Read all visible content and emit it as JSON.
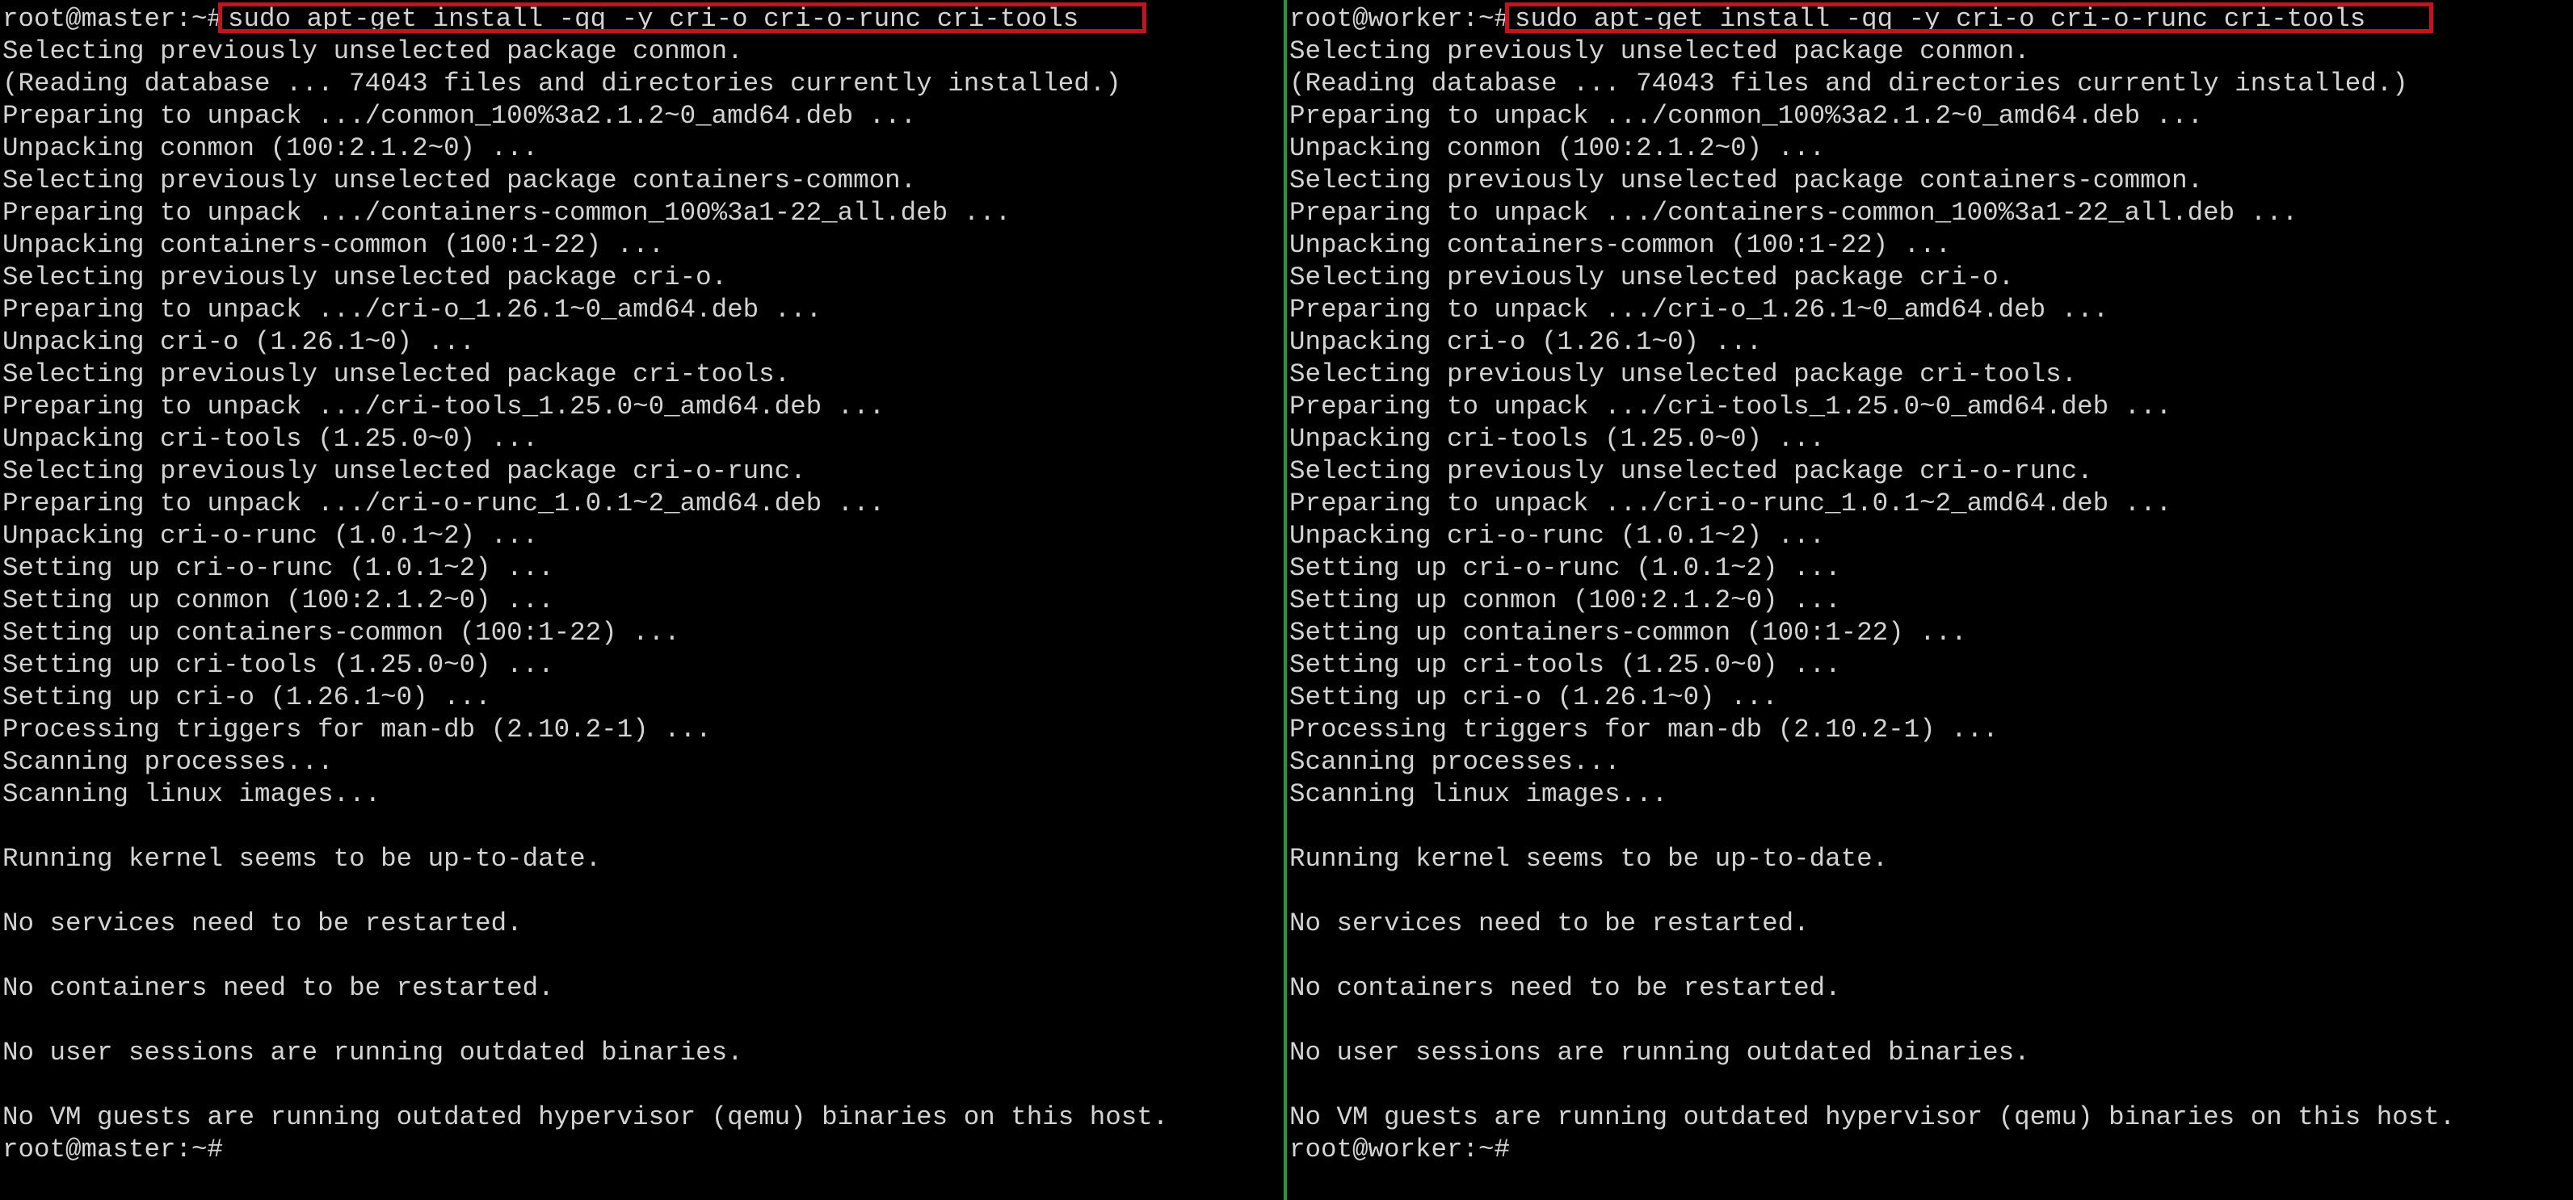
{
  "colors": {
    "background": "#000000",
    "text": "#d3d3d3",
    "divider": "#1d9b3c",
    "highlight": "#c0141f"
  },
  "panes": [
    {
      "prompt": "root@master:~#",
      "command": "sudo apt-get install -qq -y cri-o cri-o-runc cri-tools",
      "output": [
        "Selecting previously unselected package conmon.",
        "(Reading database ... 74043 files and directories currently installed.)",
        "Preparing to unpack .../conmon_100%3a2.1.2~0_amd64.deb ...",
        "Unpacking conmon (100:2.1.2~0) ...",
        "Selecting previously unselected package containers-common.",
        "Preparing to unpack .../containers-common_100%3a1-22_all.deb ...",
        "Unpacking containers-common (100:1-22) ...",
        "Selecting previously unselected package cri-o.",
        "Preparing to unpack .../cri-o_1.26.1~0_amd64.deb ...",
        "Unpacking cri-o (1.26.1~0) ...",
        "Selecting previously unselected package cri-tools.",
        "Preparing to unpack .../cri-tools_1.25.0~0_amd64.deb ...",
        "Unpacking cri-tools (1.25.0~0) ...",
        "Selecting previously unselected package cri-o-runc.",
        "Preparing to unpack .../cri-o-runc_1.0.1~2_amd64.deb ...",
        "Unpacking cri-o-runc (1.0.1~2) ...",
        "Setting up cri-o-runc (1.0.1~2) ...",
        "Setting up conmon (100:2.1.2~0) ...",
        "Setting up containers-common (100:1-22) ...",
        "Setting up cri-tools (1.25.0~0) ...",
        "Setting up cri-o (1.26.1~0) ...",
        "Processing triggers for man-db (2.10.2-1) ...",
        "Scanning processes...",
        "Scanning linux images...",
        "",
        "Running kernel seems to be up-to-date.",
        "",
        "No services need to be restarted.",
        "",
        "No containers need to be restarted.",
        "",
        "No user sessions are running outdated binaries.",
        "",
        "No VM guests are running outdated hypervisor (qemu) binaries on this host."
      ],
      "final_prompt": "root@master:~#"
    },
    {
      "prompt": "root@worker:~#",
      "command": "sudo apt-get install -qq -y cri-o cri-o-runc cri-tools",
      "output": [
        "Selecting previously unselected package conmon.",
        "(Reading database ... 74043 files and directories currently installed.)",
        "Preparing to unpack .../conmon_100%3a2.1.2~0_amd64.deb ...",
        "Unpacking conmon (100:2.1.2~0) ...",
        "Selecting previously unselected package containers-common.",
        "Preparing to unpack .../containers-common_100%3a1-22_all.deb ...",
        "Unpacking containers-common (100:1-22) ...",
        "Selecting previously unselected package cri-o.",
        "Preparing to unpack .../cri-o_1.26.1~0_amd64.deb ...",
        "Unpacking cri-o (1.26.1~0) ...",
        "Selecting previously unselected package cri-tools.",
        "Preparing to unpack .../cri-tools_1.25.0~0_amd64.deb ...",
        "Unpacking cri-tools (1.25.0~0) ...",
        "Selecting previously unselected package cri-o-runc.",
        "Preparing to unpack .../cri-o-runc_1.0.1~2_amd64.deb ...",
        "Unpacking cri-o-runc (1.0.1~2) ...",
        "Setting up cri-o-runc (1.0.1~2) ...",
        "Setting up conmon (100:2.1.2~0) ...",
        "Setting up containers-common (100:1-22) ...",
        "Setting up cri-tools (1.25.0~0) ...",
        "Setting up cri-o (1.26.1~0) ...",
        "Processing triggers for man-db (2.10.2-1) ...",
        "Scanning processes...",
        "Scanning linux images...",
        "",
        "Running kernel seems to be up-to-date.",
        "",
        "No services need to be restarted.",
        "",
        "No containers need to be restarted.",
        "",
        "No user sessions are running outdated binaries.",
        "",
        "No VM guests are running outdated hypervisor (qemu) binaries on this host."
      ],
      "final_prompt": "root@worker:~#"
    }
  ]
}
